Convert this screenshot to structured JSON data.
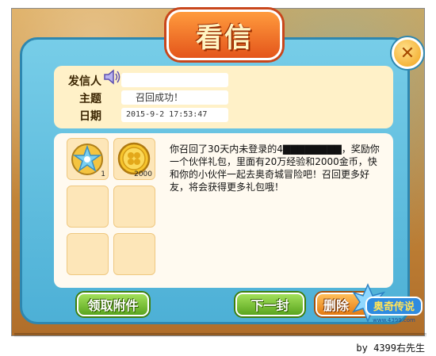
{
  "dialog": {
    "title": "看信",
    "close_label": "✕"
  },
  "header": {
    "sender_label": "发信人",
    "sender_value": "",
    "subject_label": "主题",
    "subject_value": "召回成功！",
    "date_label": "日期",
    "date_value": "2015-9-2 17:53:47"
  },
  "attachments": [
    {
      "icon": "star-medal-icon",
      "count": "1"
    },
    {
      "icon": "gold-coin-icon",
      "count": "2000"
    },
    {
      "icon": "",
      "count": ""
    },
    {
      "icon": "",
      "count": ""
    },
    {
      "icon": "",
      "count": ""
    },
    {
      "icon": "",
      "count": ""
    }
  ],
  "message": {
    "text": "你召回了30天内未登录的4▇▇▇▇▇▇▇▇，奖励你一个伙伴礼包，里面有20万经验和2000金币，快和你的小伙伴一起去奥奇城冒险吧！召回更多好友，将会获得更多礼包哦！"
  },
  "buttons": {
    "claim_label": "领取附件",
    "next_label": "下一封",
    "delete_label": "删除"
  },
  "logo": {
    "brand_text": "奥奇传说",
    "site_text": "www.4399.com"
  },
  "credit": "by 4399右先生",
  "colors": {
    "window_blue": "#5bbbe0",
    "panel_cream": "#fff1c8",
    "button_green": "#6fb92b",
    "button_orange": "#f0901b",
    "title_orange": "#f07525"
  }
}
